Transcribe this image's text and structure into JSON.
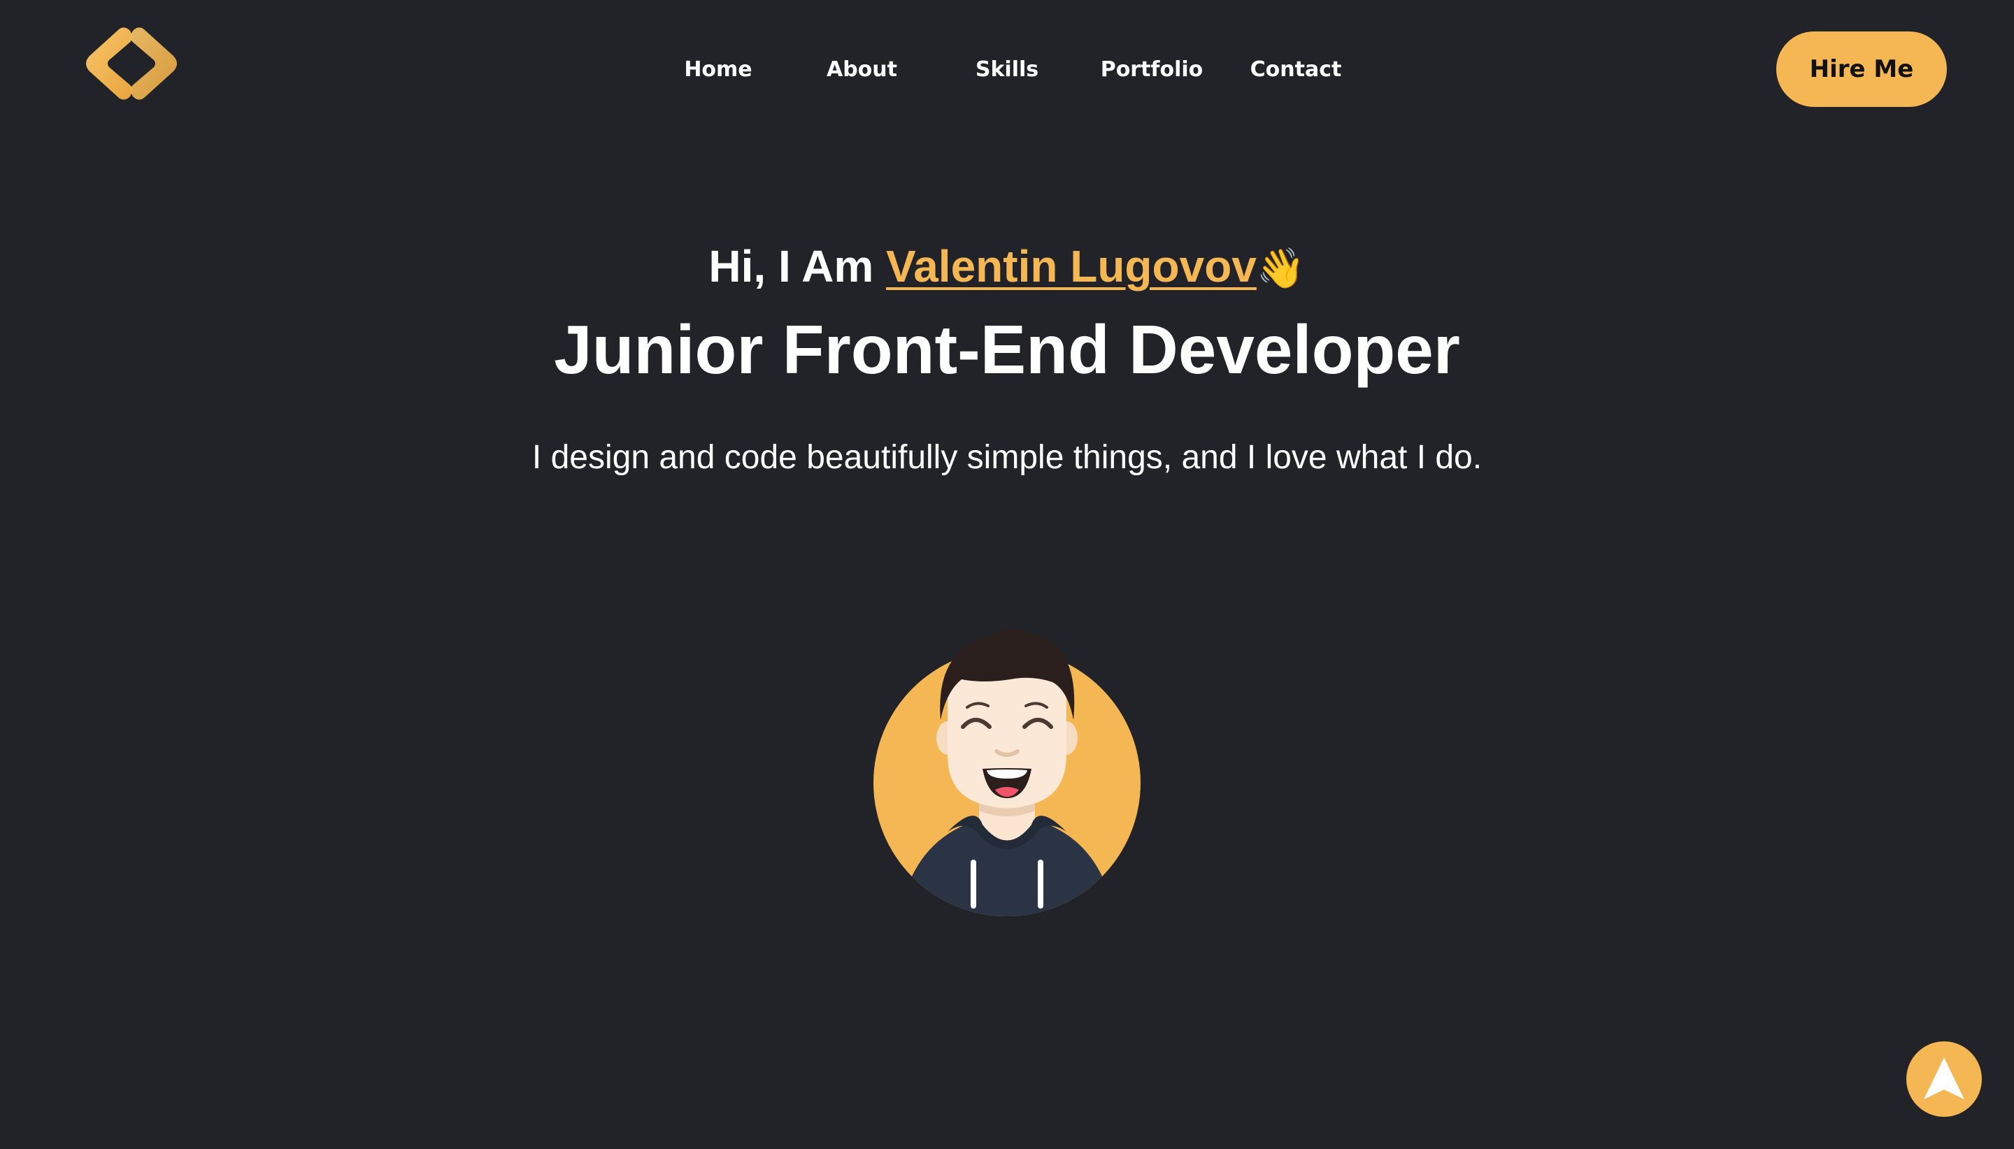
{
  "brand": {
    "logo_icon": "code-brackets-logo-icon",
    "accent_color": "#f5b654",
    "background_color": "#212328"
  },
  "nav": {
    "items": [
      {
        "label": "Home"
      },
      {
        "label": "About"
      },
      {
        "label": "Skills"
      },
      {
        "label": "Portfolio"
      },
      {
        "label": "Contact"
      }
    ]
  },
  "header": {
    "cta_label": "Hire Me"
  },
  "hero": {
    "greeting_prefix": "Hi, I Am ",
    "name": "Valentin Lugovov",
    "wave_emoji": "👋",
    "headline": "Junior Front-End Developer",
    "tagline": "I design and code beautifully simple things, and I love what I do.",
    "avatar_icon": "avatar-illustration"
  },
  "scroll_top": {
    "icon": "arrow-up-icon"
  }
}
